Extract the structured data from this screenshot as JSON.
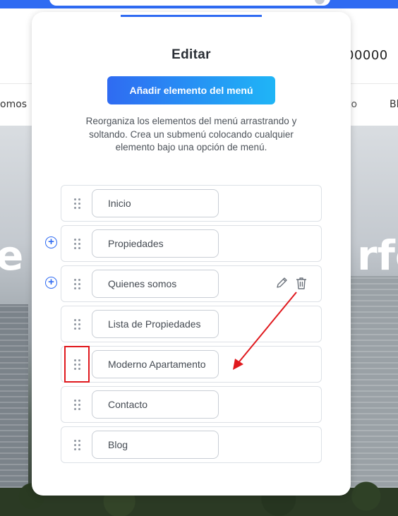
{
  "site": {
    "phone_fragment": "00000",
    "nav_left_fragment": "omos",
    "nav_right_fragment_1": "to",
    "nav_right_fragment_2": "Bl",
    "hero_text_left": "e",
    "hero_text_right": "rfe"
  },
  "modal": {
    "title": "Editar",
    "add_button_label": "Añadir elemento del menú",
    "instructions": "Reorganiza los elementos del menú arrastrando y soltando. Crea un submenú colocando cualquier elemento bajo una opción de menú.",
    "items": [
      {
        "label": "Inicio",
        "has_add": false,
        "show_actions": false
      },
      {
        "label": "Propiedades",
        "has_add": true,
        "show_actions": false
      },
      {
        "label": "Quienes somos",
        "has_add": true,
        "show_actions": true
      },
      {
        "label": "Lista de Propiedades",
        "has_add": false,
        "show_actions": false
      },
      {
        "label": "Moderno Apartamento",
        "has_add": false,
        "show_actions": false
      },
      {
        "label": "Contacto",
        "has_add": false,
        "show_actions": false
      },
      {
        "label": "Blog",
        "has_add": false,
        "show_actions": false
      }
    ]
  },
  "icons": {
    "drag": "drag-handle-icon",
    "add": "plus-circle-icon",
    "edit": "pencil-icon",
    "delete": "trash-icon"
  },
  "annotation": {
    "highlight_color": "#e0191e",
    "arrow_color": "#e0191e"
  },
  "colors": {
    "accent": "#2f6bf2",
    "button_gradient_end": "#1fb5f6"
  }
}
